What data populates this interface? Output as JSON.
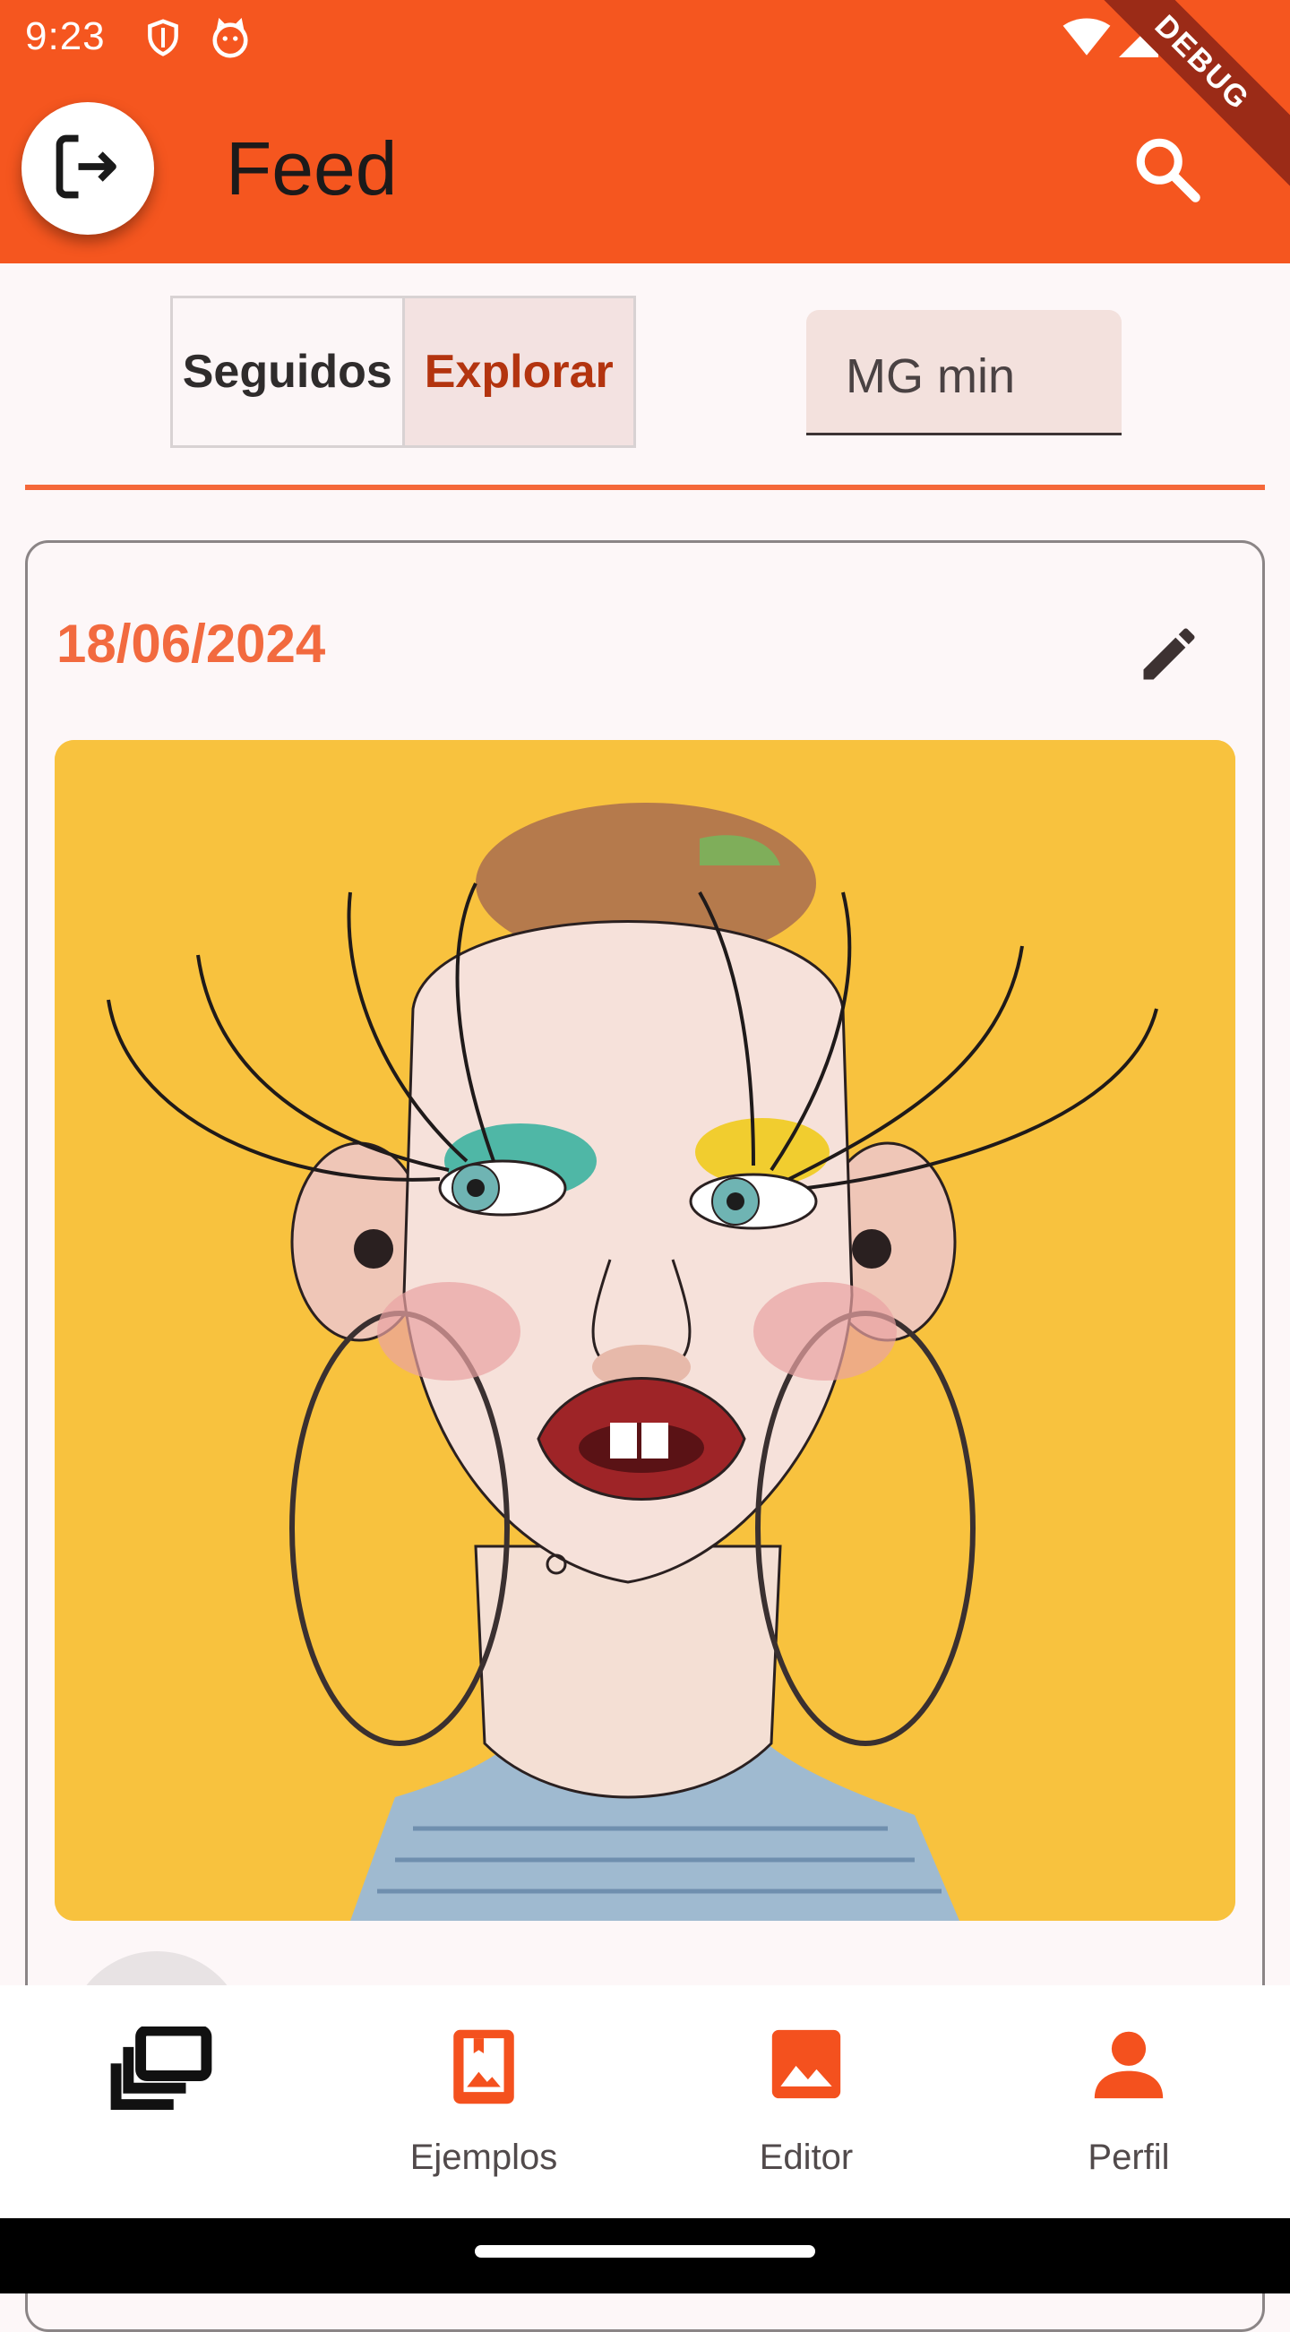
{
  "status_bar": {
    "time": "9:23",
    "icons": [
      "shield-icon",
      "cat-notification-icon",
      "wifi-icon",
      "signal-icon",
      "battery-icon"
    ],
    "debug_banner": "DEBUG"
  },
  "app_bar": {
    "title": "Feed",
    "leading_icon": "logout-icon",
    "trailing_icon": "search-icon",
    "color": "#f5561f"
  },
  "tabs": {
    "items": [
      {
        "label": "Seguidos",
        "selected": false
      },
      {
        "label": "Explorar",
        "selected": true
      }
    ]
  },
  "filter": {
    "value": "MG min"
  },
  "post": {
    "date": "18/06/2024",
    "edit_icon": "pencil-icon",
    "image_description_icon": "illustration-woman-face"
  },
  "bottom_nav": {
    "items": [
      {
        "label": "",
        "icon": "feed-stack-icon",
        "selected": true
      },
      {
        "label": "Ejemplos",
        "icon": "photo-album-icon",
        "selected": false
      },
      {
        "label": "Editor",
        "icon": "image-icon",
        "selected": false
      },
      {
        "label": "Perfil",
        "icon": "person-icon",
        "selected": false
      }
    ]
  },
  "colors": {
    "accent": "#f5561f",
    "date": "#f26a3f",
    "selected_tab_text": "#b3340f",
    "image_background": "#f8c23e"
  }
}
